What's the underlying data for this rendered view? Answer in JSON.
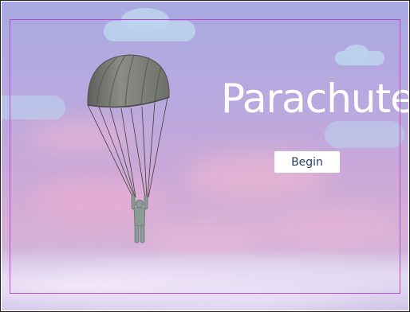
{
  "game": {
    "title": "Parachute",
    "begin_label": "Begin"
  },
  "colors": {
    "sky_top": "#a9a9e2",
    "sky_bottom": "#d7b0d6",
    "title_text": "#ffffff",
    "button_bg": "#ffffff",
    "button_text": "#283e6a",
    "canopy": "#7e7f7a",
    "guide_border": "#b44bd0"
  },
  "icons": [
    "parachute-canopy",
    "parachutist-figure"
  ]
}
